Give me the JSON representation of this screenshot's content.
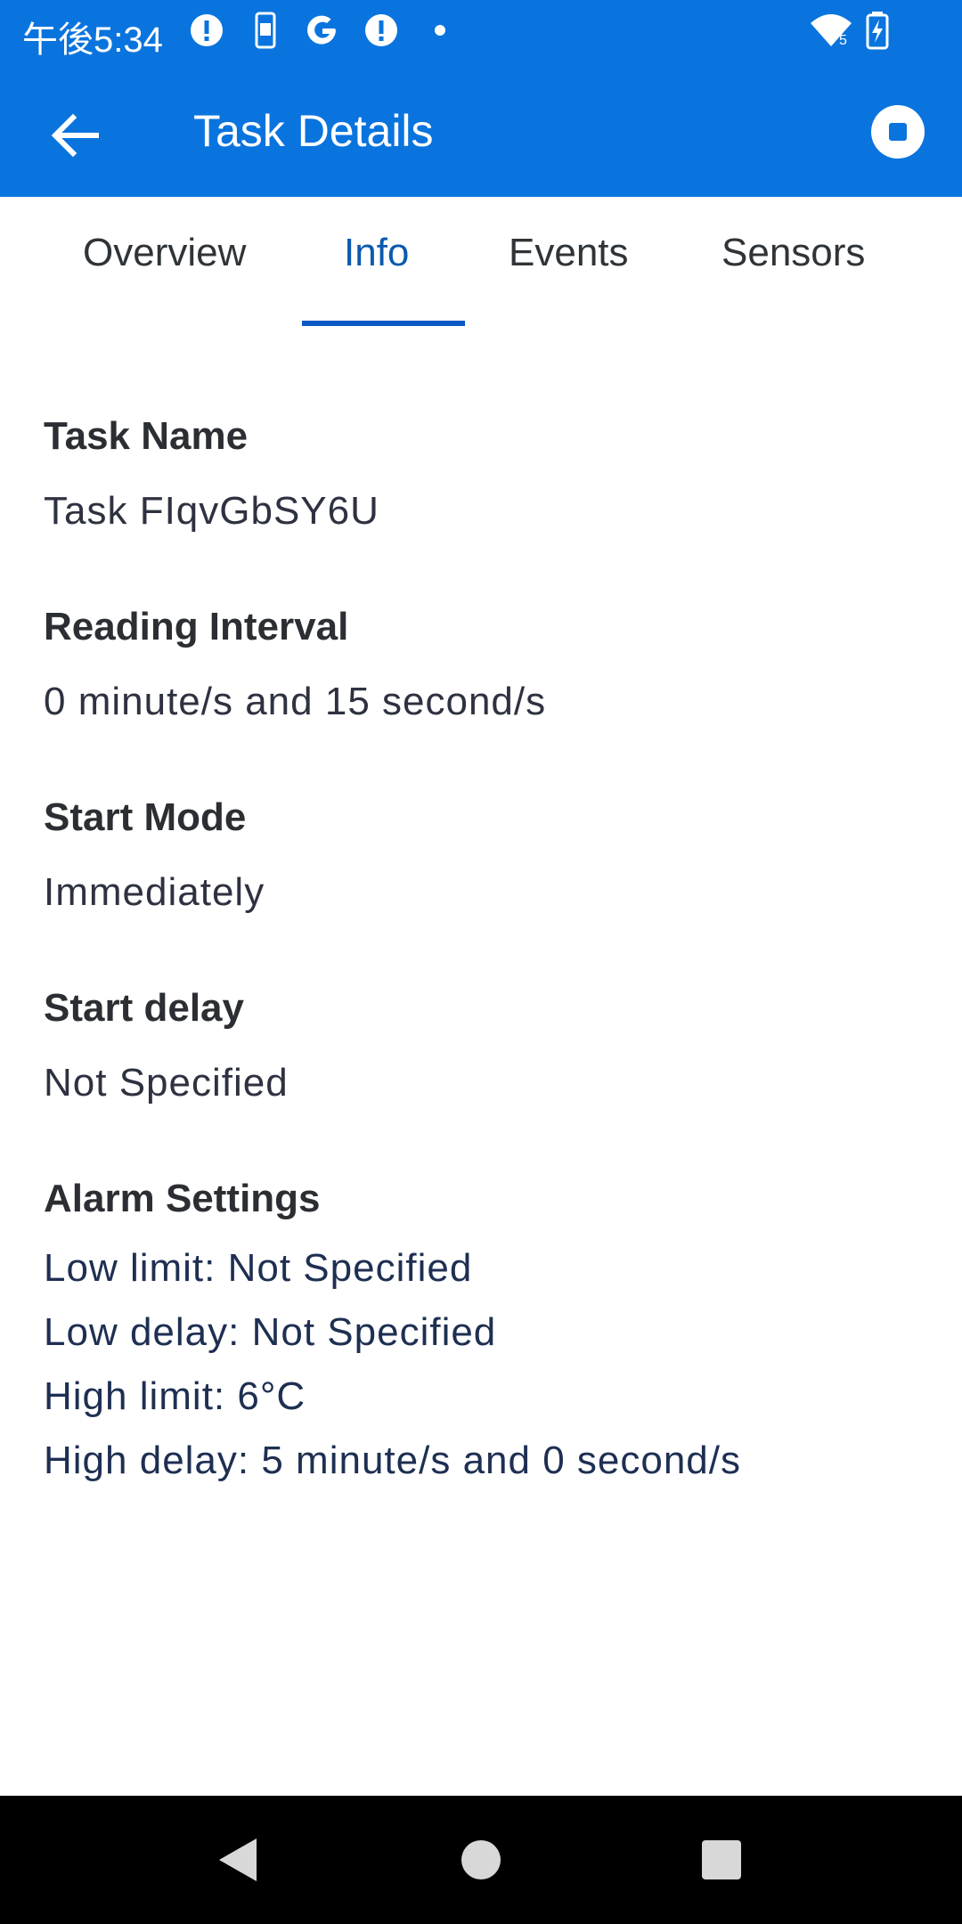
{
  "status_bar": {
    "time": "午後5:34",
    "icons_left": [
      "alert-icon",
      "phone-icon",
      "google-icon",
      "alert-icon",
      "dot-icon"
    ],
    "icons_right": [
      "wifi-icon",
      "battery-charging-icon"
    ],
    "wifi_badge": "5"
  },
  "app_bar": {
    "title": "Task Details",
    "back_icon": "back-arrow-icon",
    "action_icon": "stop-icon",
    "background": "#0a74de"
  },
  "tabs": [
    {
      "label": "Overview",
      "active": false
    },
    {
      "label": "Info",
      "active": true
    },
    {
      "label": "Events",
      "active": false
    },
    {
      "label": "Sensors",
      "active": false
    }
  ],
  "info": {
    "task_name": {
      "label": "Task Name",
      "value": "Task FIqvGbSY6U"
    },
    "reading_interval": {
      "label": "Reading Interval",
      "value": "0 minute/s and 15 second/s"
    },
    "start_mode": {
      "label": "Start Mode",
      "value": "Immediately"
    },
    "start_delay": {
      "label": "Start delay",
      "value": "Not Specified"
    },
    "alarm_settings": {
      "label": "Alarm Settings",
      "lines": [
        "Low limit: Not Specified",
        "Low delay: Not Specified",
        "High limit: 6°C",
        "High delay: 5 minute/s and 0 second/s"
      ]
    }
  },
  "nav_bar": {
    "icons": [
      "back-triangle-icon",
      "home-circle-icon",
      "recents-square-icon"
    ]
  }
}
